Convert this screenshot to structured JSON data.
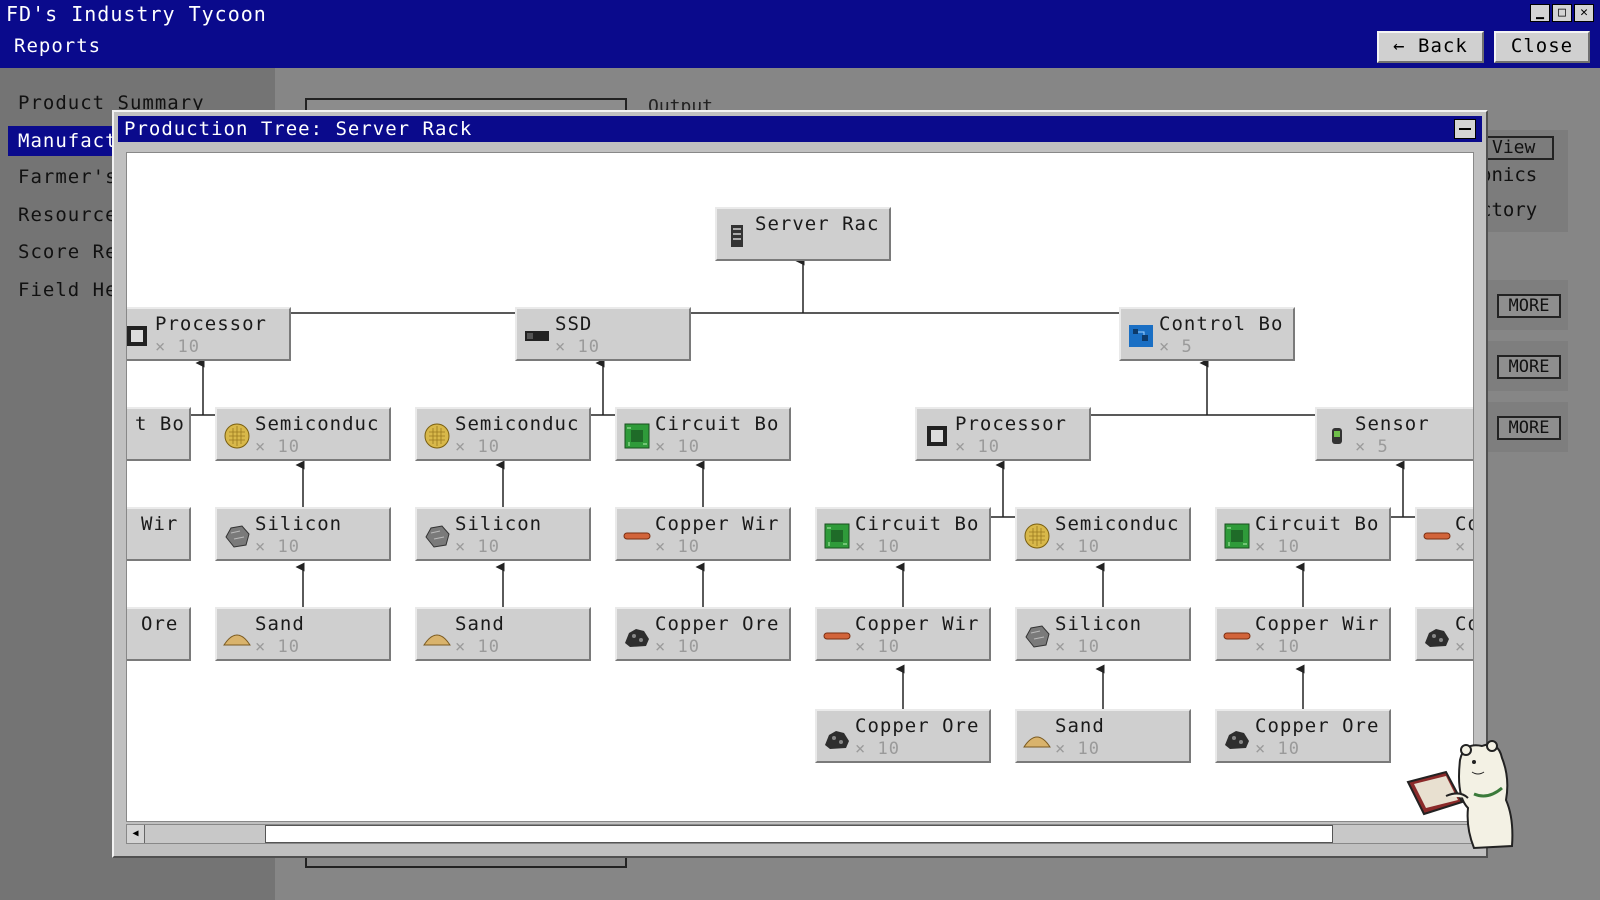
{
  "app": {
    "title": "FD's Industry Tycoon",
    "subtitle": "Reports",
    "back_label": "← Back",
    "close_label": "Close",
    "window_controls": [
      "minimize-icon",
      "maximize-icon",
      "close-icon"
    ]
  },
  "sidebar": {
    "items": [
      {
        "label": "Product Summary"
      },
      {
        "label": "Manufact"
      },
      {
        "label": "Farmer's"
      },
      {
        "label": "Resource"
      },
      {
        "label": "Score Re"
      },
      {
        "label": "Field He"
      }
    ],
    "active_index": 1
  },
  "background": {
    "output_label": "Output",
    "view_label": "View",
    "text1": "onics",
    "text2": "ctory",
    "more_labels": [
      "MORE",
      "MORE",
      "MORE"
    ]
  },
  "tree_window": {
    "title": "Production Tree:  Server Rack"
  },
  "tree": {
    "nodes": [
      {
        "name": "Server Rac",
        "qty": "",
        "icon": "server-icon"
      },
      {
        "name": "Processor",
        "qty": "× 10",
        "icon": "processor-icon"
      },
      {
        "name": "SSD",
        "qty": "× 10",
        "icon": "ssd-icon"
      },
      {
        "name": "Control Bo",
        "qty": "× 5",
        "icon": "control-board-icon"
      },
      {
        "name": "t Bo",
        "qty": "",
        "icon": ""
      },
      {
        "name": "Semiconduc",
        "qty": "× 10",
        "icon": "semiconductor-icon"
      },
      {
        "name": "Semiconduc",
        "qty": "× 10",
        "icon": "semiconductor-icon"
      },
      {
        "name": "Circuit Bo",
        "qty": "× 10",
        "icon": "circuit-board-icon"
      },
      {
        "name": "Processor",
        "qty": "× 10",
        "icon": "processor-icon"
      },
      {
        "name": "Sensor",
        "qty": "× 5",
        "icon": "sensor-icon"
      },
      {
        "name": "Wir",
        "qty": "",
        "icon": ""
      },
      {
        "name": "Silicon",
        "qty": "× 10",
        "icon": "silicon-icon"
      },
      {
        "name": "Silicon",
        "qty": "× 10",
        "icon": "silicon-icon"
      },
      {
        "name": "Copper Wir",
        "qty": "× 10",
        "icon": "copper-wire-icon"
      },
      {
        "name": "Circuit Bo",
        "qty": "× 10",
        "icon": "circuit-board-icon"
      },
      {
        "name": "Semiconduc",
        "qty": "× 10",
        "icon": "semiconductor-icon"
      },
      {
        "name": "Circuit Bo",
        "qty": "× 10",
        "icon": "circuit-board-icon"
      },
      {
        "name": "Co",
        "qty": "×",
        "icon": "copper-wire-icon"
      },
      {
        "name": "Ore",
        "qty": "",
        "icon": ""
      },
      {
        "name": "Sand",
        "qty": "× 10",
        "icon": "sand-icon"
      },
      {
        "name": "Sand",
        "qty": "× 10",
        "icon": "sand-icon"
      },
      {
        "name": "Copper Ore",
        "qty": "× 10",
        "icon": "copper-ore-icon"
      },
      {
        "name": "Copper Wir",
        "qty": "× 10",
        "icon": "copper-wire-icon"
      },
      {
        "name": "Silicon",
        "qty": "× 10",
        "icon": "silicon-icon"
      },
      {
        "name": "Copper Wir",
        "qty": "× 10",
        "icon": "copper-wire-icon"
      },
      {
        "name": "Co",
        "qty": "×",
        "icon": "copper-ore-icon"
      },
      {
        "name": "Copper Ore",
        "qty": "× 10",
        "icon": "copper-ore-icon"
      },
      {
        "name": "Sand",
        "qty": "× 10",
        "icon": "sand-icon"
      },
      {
        "name": "Copper Ore",
        "qty": "× 10",
        "icon": "copper-ore-icon"
      }
    ]
  },
  "colors": {
    "title_bar": "#0a0a8c",
    "node_bg": "#cfcfcf",
    "canvas_bg": "#ffffff"
  }
}
